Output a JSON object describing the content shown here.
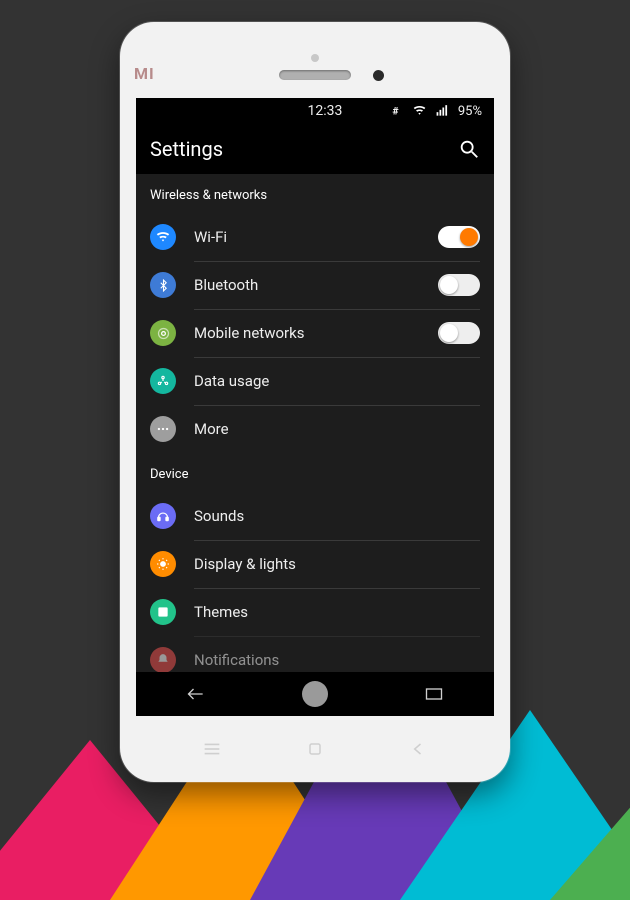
{
  "brand_logo_text": "MI",
  "status": {
    "time": "12:33",
    "battery": "95%"
  },
  "appbar": {
    "title": "Settings"
  },
  "sections": [
    {
      "header": "Wireless & networks",
      "items": [
        {
          "label": "Wi-Fi",
          "toggle": true,
          "on": true,
          "icon_bg": "#1e88ff"
        },
        {
          "label": "Bluetooth",
          "toggle": true,
          "on": false,
          "icon_bg": "#3e7bd6"
        },
        {
          "label": "Mobile networks",
          "toggle": true,
          "on": false,
          "icon_bg": "#7cb342"
        },
        {
          "label": "Data usage",
          "toggle": false,
          "icon_bg": "#14b79f"
        },
        {
          "label": "More",
          "toggle": false,
          "icon_bg": "#9e9e9e"
        }
      ]
    },
    {
      "header": "Device",
      "items": [
        {
          "label": "Sounds",
          "toggle": false,
          "icon_bg": "#6b6cf5"
        },
        {
          "label": "Display & lights",
          "toggle": false,
          "icon_bg": "#ff8c00"
        },
        {
          "label": "Themes",
          "toggle": false,
          "icon_bg": "#22c38a"
        },
        {
          "label": "Notifications",
          "toggle": false,
          "icon_bg": "#ef5350"
        }
      ]
    }
  ]
}
